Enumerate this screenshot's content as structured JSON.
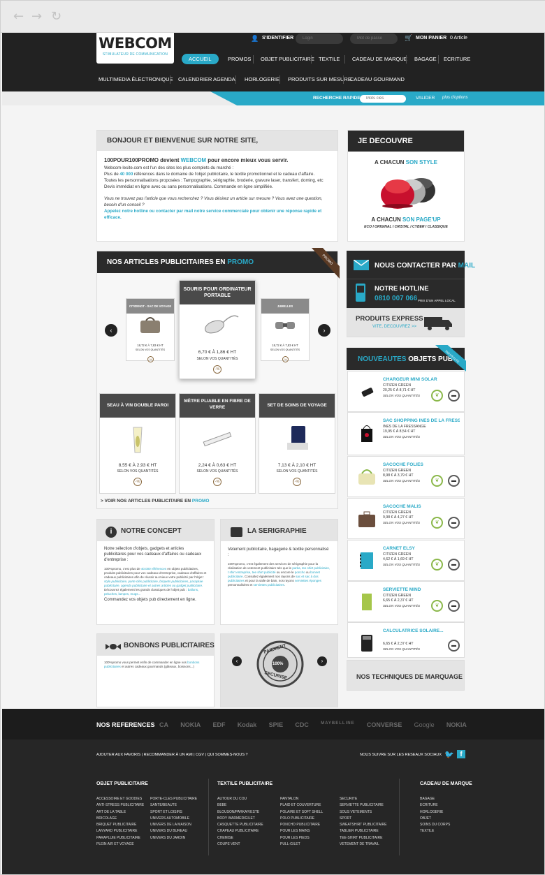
{
  "browser": {
    "back": "←",
    "forward": "→",
    "reload": "↻"
  },
  "logo": {
    "name": "WEBCOM",
    "tagline": "STIMULATEUR DE COMMUNICATION"
  },
  "account": {
    "signin": "S'IDENTIFIER",
    "login_placeholder": "Login",
    "password_placeholder": "Mot de passe",
    "cart_label": "MON PANIER",
    "cart_count": "0 Article"
  },
  "nav_row1": [
    "ACCUEIL",
    "PROMOS",
    "OBJET PUBLICITAIRE",
    "TEXTILE",
    "CADEAU DE MARQUE",
    "BAGAGE",
    "ECRITURE"
  ],
  "nav_row2": [
    "MULTIMEDIA ÉLECTRONIQUE",
    "CALENDRIER AGENDA",
    "HORLOGERIE",
    "PRODUITS SUR MESURE",
    "CADEAU GOURMAND"
  ],
  "search": {
    "label": "RECHERCHE RAPIDE",
    "placeholder": "Mots clés",
    "submit": "VALIDER",
    "options": "plus d'options"
  },
  "welcome": {
    "title": "BONJOUR ET BIENVENUE SUR NOTRE SITE,",
    "lead_a": "100POUR100PROMO devient ",
    "lead_b": "WEBCOM",
    "lead_c": " pour encore mieux vous servir.",
    "p1": "Webcom-lesite.com est l'un des sites les plus complets du marché :",
    "p2a": "Plus  de ",
    "p2b": "40 000",
    "p2c": " références dans le domaine de l'objet publicitaire, le textile promotionnel et le cadeau d'affaire.",
    "p3": "Toutes les personnalisations proposées : Tampographie, sérigraphie, broderie, gravure laser, transfert, doming, etc",
    "p4": "Devis immédiat en ligne avec ou sans personnalisations. Commande en ligne simplifiée.",
    "q": "Vous ne trouvez pas l'article que vous recherchez ? Vous désirez un article sur mesure ? Vous avez une question, besoin d'un conseil ?",
    "cta": "Appelez  notre hotline ou contacter par mail notre service commerciale pour obtenir une réponse rapide et efficace."
  },
  "discover": {
    "title": "JE DECOUVRE",
    "l1a": "A CHACUN ",
    "l1b": "SON STYLE",
    "l2a": "A CHACUN ",
    "l2b": "SON PAGE'UP",
    "sub": "ECO I ORIGINAL I CRISTAL I CYBER I CLASSIQUE"
  },
  "promo": {
    "title_a": "NOS ARTICLES PUBLICITAIRES EN ",
    "title_b": "PROMO",
    "ribbon": "PROMO",
    "link_a": "> VOIR NOS ARTICLES PUBLICITAIRE EN ",
    "link_b": "PROMO",
    "carousel": [
      {
        "name": "CITIZENGT - SAC DE VOYAGE",
        "price": "18,72 € À 7,83 € HT",
        "qty": "SELON VOS QUANTITÉS"
      },
      {
        "name": "SOURIS POUR ORDINATEUR PORTABLE",
        "price": "6,70 € À 1,86 € HT",
        "qty": "SELON VOS QUANTITÉS"
      },
      {
        "name": "JUMELLES",
        "price": "18,72 € À 7,83 € HT",
        "qty": "SELON VOS QUANTITÉS"
      }
    ],
    "grid": [
      {
        "name": "SEAU À VIN DOUBLE PAROI",
        "price": "8,55 € À 2,93 € HT",
        "qty": "SELON VOS QUANTITÉS"
      },
      {
        "name": "MÈTRE PLIABLE EN FIBRE DE VERRE",
        "price": "2,24 € À 0,63 € HT",
        "qty": "SELON VOS QUANTITÉS"
      },
      {
        "name": "SET DE SOINS DE VOYAGE",
        "price": "7,13 € À 2,10 € HT",
        "qty": "SELON VOS QUANTITÉS"
      }
    ],
    "pct": "-%"
  },
  "contact": {
    "title_a": "NOUS CONTACTER PAR ",
    "title_b": "MAIL",
    "hotline": "NOTRE HOTLINE",
    "phone": "0810 007 066",
    "phone_note": "PRIX D'UN APPEL LOCAL",
    "express": "PRODUITS EXPRESS",
    "express_link": "VITE, DECOUVREZ >>"
  },
  "news": {
    "title_a": "NOUVEAUTES",
    "title_b": " OBJETS PUB",
    "ribbon": "NOUVEAUTE",
    "items": [
      {
        "name": "CHARGEUR MINI SOLAR",
        "brand": "CITIZEN GREEN",
        "price": "20,25 € À 8,71 € HT",
        "qty": "SELON VOS QUANTITÉS"
      },
      {
        "name": "SAC SHOPPING INES DE LA FRESS...",
        "brand": "INES DE LA FRESSANGE",
        "price": "19,95 € À 8,54 € HT",
        "qty": "SELON VOS QUANTITÉS"
      },
      {
        "name": "SACOCHE FOLIES",
        "brand": "CITIZEN GREEN",
        "price": "8,98 € À 3,79 € HT",
        "qty": "SELON VOS QUANTITÉS"
      },
      {
        "name": "SACOCHE MALIS",
        "brand": "CITIZEN GREEN",
        "price": "9,98 € À 4,27 € HT",
        "qty": "SELON VOS QUANTITÉS"
      },
      {
        "name": "CARNET ELSY",
        "brand": "CITIZEN GREEN",
        "price": "4,62 € À 1,69 € HT",
        "qty": "SELON VOS QUANTITÉS"
      },
      {
        "name": "SERVIETTE MIND",
        "brand": "CITIZEN GREEN",
        "price": "6,65 € À 2,37 € HT",
        "qty": "SELON VOS QUANTITÉS"
      },
      {
        "name": "CALCULATRICE SOLAIRE...",
        "brand": "",
        "price": "6,65 € À 2,37 € HT",
        "qty": "SELON VOS QUANTITÉS"
      }
    ]
  },
  "concept": {
    "title": "NOTRE CONCEPT",
    "lead": "Notre sélection d'objets, gadgets et articles publicitaires pour vos cadeaux d'affaires ou cadeaux d'entreprise :",
    "b1a": "100%promo, c'est plus de ",
    "b1b": "40.000 références",
    "b1c": " en objets publicitaires, produits publicitaires pour vos cadeaux d'entreprise, cadeaux d'affaires et cadeaux publicitaires afin de réussir au mieux votre publicité par l'objet : ",
    "b1d": "stylo publicitaire, porte clés publicitaire, briquets publicitaires, parapluie publicitaire, agenda publicitaire et autres articles ou gadget publicitaire.",
    "b2a": "Découvrez également les grands classiques de l'objet pub : ",
    "b2b": "ballons, peluches, lampes, mugs...",
    "end": "Commandez vos objets pub directement en ligne."
  },
  "serigraphie": {
    "title": "LA SERIGRAPHIE",
    "lead": "Vetement publicitaire, bagagerie & textile personnalisé :",
    "b1": "100%promo, c'est également des services de sérigraphie pour la réalisation de vetement publicitaire tels que le ",
    "l1": "parka, tee shirt publicitaire, t shirt entreprise, tee shirt publicité",
    "b2": " ou encore le ",
    "l2": "poncho",
    "b3": " ou ",
    "l4": "bonnet publicitaire",
    "b4": ". Consultez également nos rayons de ",
    "l5": "sac et sac à dos publicitaires",
    "b5": " et pour la salle de bain, nos rayons ",
    "l6": "serviettes éponges",
    "b6": " personnalisées et ",
    "l7": "serviettes publicitaires",
    "b7": "."
  },
  "bonbons": {
    "title": "BONBONS PUBLICITAIRES",
    "b1": "100%promo vous permet enfin de commander en ligne vos ",
    "l1": "bonbons publicitaires",
    "b2": " et autres cadeaux gourmands (gâteaux, boissons...)"
  },
  "secure": {
    "line1": "PAIEMENT",
    "line2": "SECURISE",
    "center": "100%"
  },
  "techniques": {
    "title": "NOS TECHNIQUES DE MARQUAGE"
  },
  "footer": {
    "refs_title": "NOS REFERENCES",
    "brands": [
      "CA",
      "NOKIA",
      "EDF",
      "Kodak",
      "SPIE",
      "CDC",
      "MAYBELLINE",
      "CONVERSE",
      "Google",
      "NOKIA"
    ],
    "links": "AJOUTER AUX FAVORIS | RECOMMANDER À UN AMI | CGV | QUI SOMMES-NOUS ?",
    "social": "NOUS SUIVRE SUR LES RESEAUX SOCIAUX",
    "col1_title": "OBJET PUBLICITAIRE",
    "col1a": [
      "ACCESSOIRE ET GOODIES",
      "ANTI-STRESS PUBLICITAIRE",
      "ART DE LA TABLE",
      "BRICOLAGE",
      "BRIQUET PUBLICITAIRE",
      "LANYARD PUBLICITAIRE",
      "PARAPLUIE PUBLICITAIRE",
      "PLEIN AIR ET VOYAGE"
    ],
    "col1b": [
      "PORTE-CLES PUBLICITAIRE",
      "SANTE/BEAUTE",
      "SPORT ET LOISIRS",
      "UNIVERS AUTOMOBILE",
      "UNIVERS DE LA MAISON",
      "UNIVERS DU BUREAU",
      "UNIVERS DU JARDIN"
    ],
    "col2_title": "TEXTILE PUBLICITAIRE",
    "col2a": [
      "AUTOUR DU COU",
      "BEBE",
      "BLOUSON/PARKA/VESTE",
      "BODY WARMER/GILET",
      "CASQUETTE PUBLICITAIRE",
      "CHAPEAU PUBLICITAIRE",
      "CHEMISE",
      "COUPE VENT"
    ],
    "col2b": [
      "PANTALON",
      "PLAID ET COUVERTURE",
      "POLAIRE ET SOFT SHELL",
      "POLO PUBLICITAIRE",
      "PONCHO PUBLICITAIRE",
      "POUR LES MAINS",
      "POUR LES PIEDS",
      "PULL-GILET"
    ],
    "col2c": [
      "SECURITE",
      "SERVIETTE PUBLICITAIRE",
      "SOUS VETEMENTS",
      "SPORT",
      "SWEATSHIRT PUBLICITAIRE",
      "TABLIER PUBLICITAIRE",
      "TEE-SHIRT PUBLICITAIRE",
      "VETEMENT DE TRAVAIL"
    ],
    "col3_title": "CADEAU DE MARQUE",
    "col3": [
      "BAGAGE",
      "ECRITURE",
      "HORLOGERIE",
      "OBJET",
      "SOINS DU CORPS",
      "TEXTILE"
    ]
  },
  "colors": {
    "accent": "#29a9c7",
    "dark": "#222222",
    "promo_ribbon": "#5a3a24"
  }
}
